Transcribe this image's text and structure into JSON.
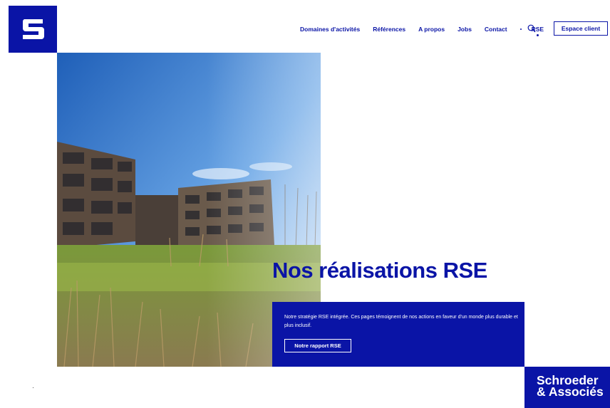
{
  "header": {
    "logo_letter": "S",
    "nav": [
      {
        "label": "Domaines d'activités"
      },
      {
        "label": "Références"
      },
      {
        "label": "A propos"
      },
      {
        "label": "Jobs"
      },
      {
        "label": "Contact"
      },
      {
        "label": "RSE",
        "active": true
      }
    ],
    "search_icon": "search-icon",
    "client_button": "Espace client"
  },
  "hero": {
    "image_alt": "",
    "title": "Nos réalisations RSE",
    "description": "Notre stratégie RSE intégrée. Ces pages témoignent de nos actions en faveur d'un monde plus durable et plus inclusif.",
    "button": "Notre rapport RSE"
  },
  "brand": {
    "line1": "Schroeder",
    "line2": "& Associés"
  },
  "colors": {
    "primary": "#0a14a6",
    "background": "#ffffff"
  }
}
